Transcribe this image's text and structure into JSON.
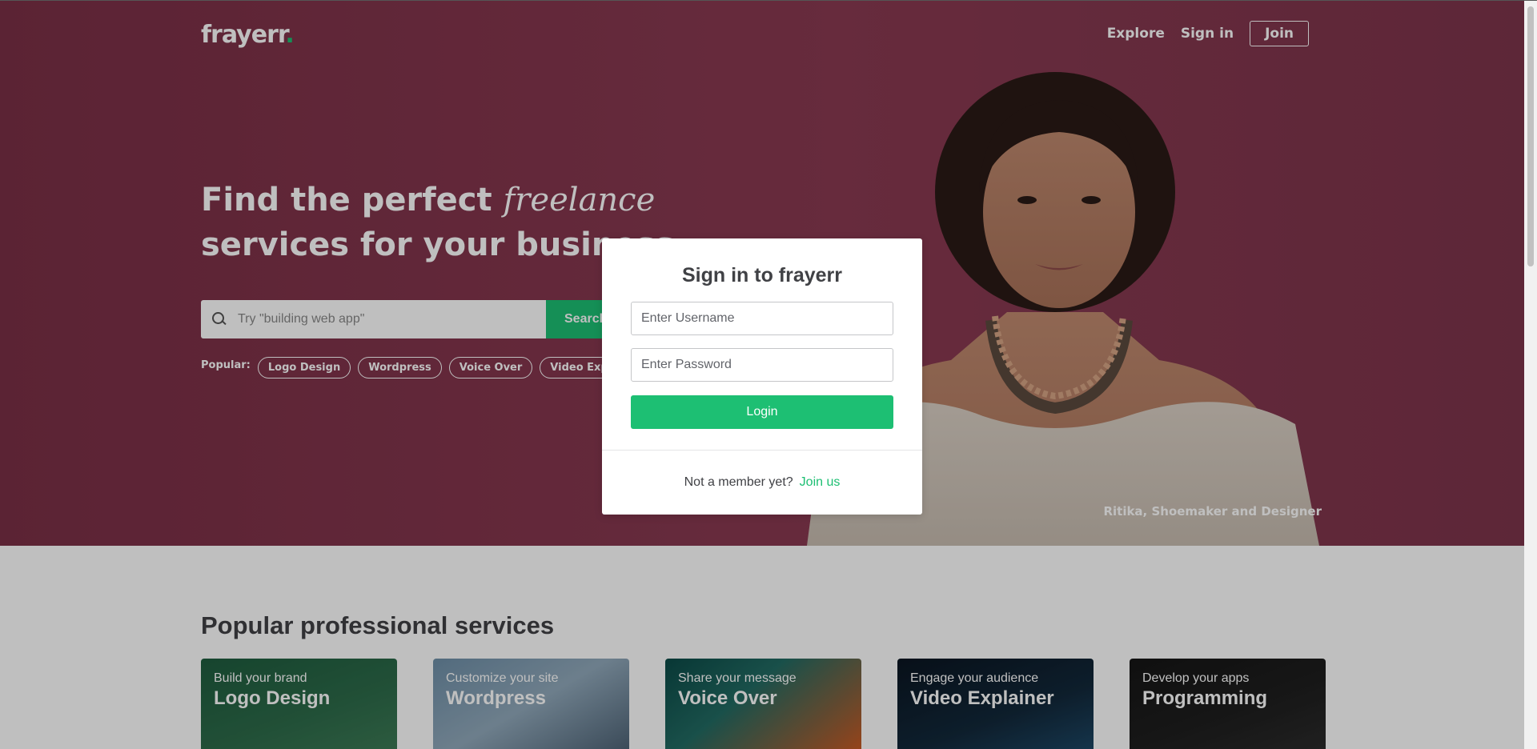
{
  "header": {
    "logo_text": "frayerr",
    "logo_dot": ".",
    "nav": {
      "explore": "Explore",
      "sign_in": "Sign in",
      "join": "Join"
    }
  },
  "hero": {
    "headline_part1": "Find the perfect ",
    "headline_italic": "freelance",
    "headline_line2": "services for your business",
    "search": {
      "placeholder": "Try \"building web app\"",
      "button_label": "Search"
    },
    "popular_label": "Popular:",
    "popular_tags": [
      "Logo Design",
      "Wordpress",
      "Voice Over",
      "Video Explainer"
    ],
    "caption": "Ritika, Shoemaker and Designer"
  },
  "services": {
    "title": "Popular professional services",
    "cards": [
      {
        "subtitle": "Build your brand",
        "title": "Logo Design"
      },
      {
        "subtitle": "Customize your site",
        "title": "Wordpress"
      },
      {
        "subtitle": "Share your message",
        "title": "Voice Over"
      },
      {
        "subtitle": "Engage your audience",
        "title": "Video Explainer"
      },
      {
        "subtitle": "Develop your apps",
        "title": "Programming"
      }
    ]
  },
  "modal": {
    "title": "Sign in to frayerr",
    "username_placeholder": "Enter Username",
    "password_placeholder": "Enter Password",
    "login_label": "Login",
    "footer_text": "Not a member yet?",
    "footer_link": "Join us"
  },
  "colors": {
    "brand_green": "#1dbf73",
    "hero_bg": "#8a3a52",
    "text_dark": "#404145"
  }
}
